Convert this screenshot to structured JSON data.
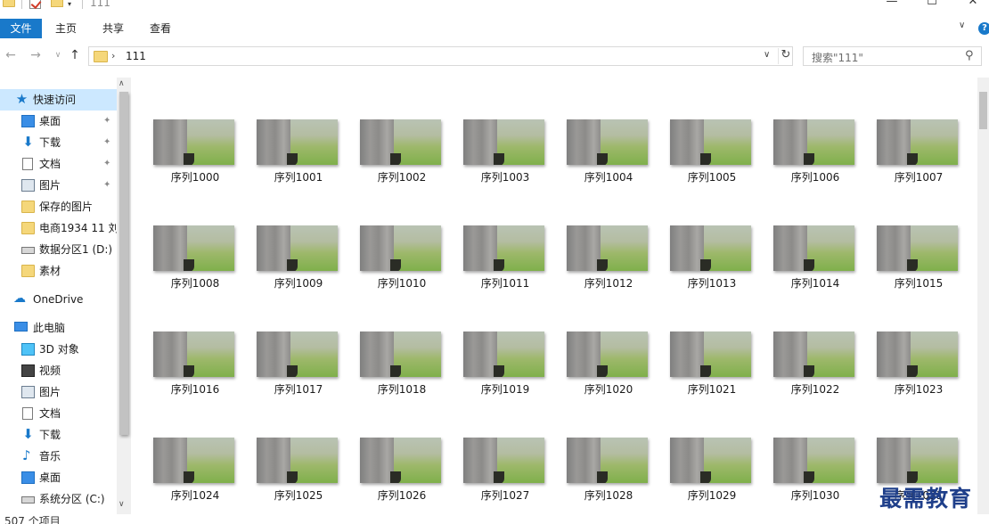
{
  "window": {
    "title": "111",
    "minimize": "—",
    "maximize": "☐",
    "close": "✕"
  },
  "ribbon": {
    "tabs": [
      "文件",
      "主页",
      "共享",
      "查看"
    ],
    "help": "?"
  },
  "address": {
    "path": "111",
    "separator": "›",
    "search_placeholder": "搜索\"111\""
  },
  "nav_pane": {
    "items": [
      {
        "label": "快速访问",
        "icon": "star-icon"
      },
      {
        "label": "桌面",
        "icon": "desktop-icon",
        "pinned": true
      },
      {
        "label": "下载",
        "icon": "download-icon",
        "pinned": true
      },
      {
        "label": "文档",
        "icon": "document-icon",
        "pinned": true
      },
      {
        "label": "图片",
        "icon": "picture-icon",
        "pinned": true
      },
      {
        "label": "保存的图片",
        "icon": "folder-icon"
      },
      {
        "label": "电商1934 11 刘",
        "icon": "folder-icon"
      },
      {
        "label": "数据分区1 (D:)",
        "icon": "drive-icon"
      },
      {
        "label": "素材",
        "icon": "folder-icon"
      },
      {
        "label": "OneDrive",
        "icon": "cloud-icon"
      },
      {
        "label": "此电脑",
        "icon": "computer-icon"
      },
      {
        "label": "3D 对象",
        "icon": "3d-objects-icon"
      },
      {
        "label": "视频",
        "icon": "video-icon"
      },
      {
        "label": "图片",
        "icon": "picture-icon"
      },
      {
        "label": "文档",
        "icon": "document-icon"
      },
      {
        "label": "下载",
        "icon": "download-icon"
      },
      {
        "label": "音乐",
        "icon": "music-icon"
      },
      {
        "label": "桌面",
        "icon": "desktop-icon"
      },
      {
        "label": "系统分区 (C:)",
        "icon": "drive-icon"
      }
    ]
  },
  "files": [
    "序列1000",
    "序列1001",
    "序列1002",
    "序列1003",
    "序列1004",
    "序列1005",
    "序列1006",
    "序列1007",
    "序列1008",
    "序列1009",
    "序列1010",
    "序列1011",
    "序列1012",
    "序列1013",
    "序列1014",
    "序列1015",
    "序列1016",
    "序列1017",
    "序列1018",
    "序列1019",
    "序列1020",
    "序列1021",
    "序列1022",
    "序列1023",
    "序列1024",
    "序列1025",
    "序列1026",
    "序列1027",
    "序列1028",
    "序列1029",
    "序列1030",
    "序列1031"
  ],
  "status": {
    "item_count": "507 个项目"
  },
  "watermark": "最需教育",
  "colors": {
    "accent": "#1979ca",
    "selected_bg": "#cce8ff",
    "folder": "#f5d77a"
  }
}
